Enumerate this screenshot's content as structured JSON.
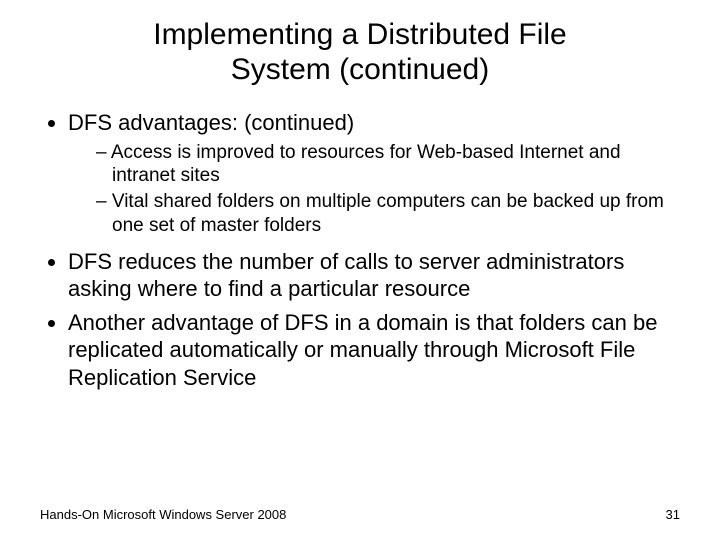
{
  "title_line1": "Implementing a Distributed File",
  "title_line2": "System (continued)",
  "bullets": {
    "b1": "DFS advantages: (continued)",
    "b1_sub1": "Access is improved to resources for Web-based Internet and intranet sites",
    "b1_sub2": "Vital shared folders on multiple computers can be backed up from one set of master folders",
    "b2": "DFS reduces the number of calls to server administrators asking where to find a particular resource",
    "b3": "Another advantage of DFS in a domain is that folders can be replicated automatically or manually through Microsoft File Replication Service"
  },
  "footer_left": "Hands-On Microsoft Windows Server 2008",
  "footer_right": "31"
}
